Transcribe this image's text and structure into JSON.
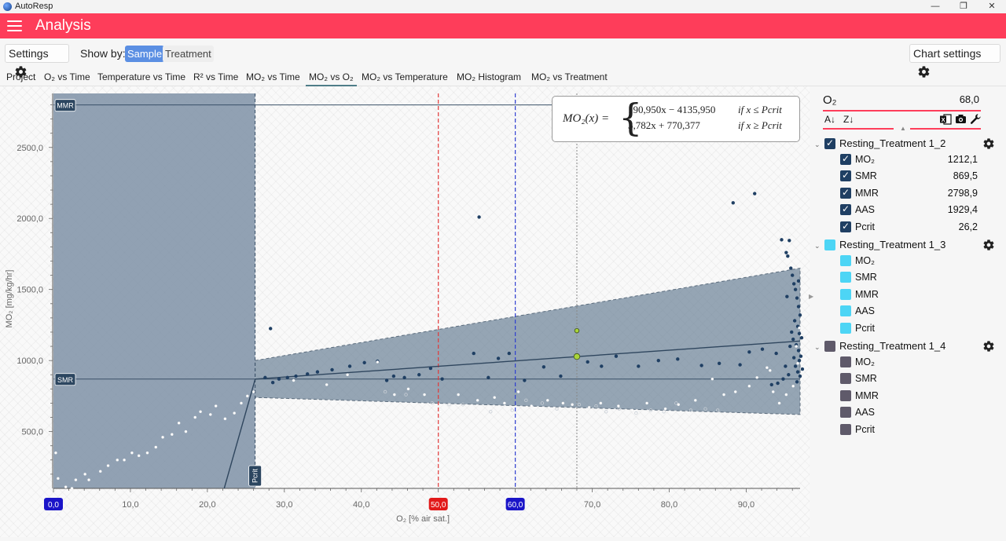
{
  "window": {
    "app_name": "AutoResp",
    "minimize": "—",
    "restore": "❐",
    "close": "✕"
  },
  "header": {
    "title": "Analysis"
  },
  "toolbar": {
    "settings_label": "Settings",
    "show_by_label": "Show by:",
    "show_by_options": [
      "Sample",
      "Treatment"
    ],
    "show_by_selected": "Sample",
    "chart_settings_label": "Chart settings"
  },
  "tabs": [
    {
      "label": "Project"
    },
    {
      "label": "O₂ vs Time"
    },
    {
      "label": "Temperature vs Time"
    },
    {
      "label": "R² vs Time"
    },
    {
      "label": "MO₂ vs Time"
    },
    {
      "label": "MO₂ vs O₂"
    },
    {
      "label": "MO₂ vs Temperature"
    },
    {
      "label": "MO₂ Histogram"
    },
    {
      "label": "MO₂ vs Treatment"
    }
  ],
  "selected_tab": "MO₂ vs O₂",
  "chart_data": {
    "type": "scatter",
    "xlabel": "O₂ [% air sat.]",
    "ylabel": "MO₂ [mg/kg/hr]",
    "xlim": [
      0,
      97
    ],
    "ylim": [
      100,
      2880
    ],
    "x_ticks": [
      "10,0",
      "20,0",
      "30,0",
      "40,0",
      "50,0",
      "60,0",
      "70,0",
      "80,0",
      "90,0"
    ],
    "y_ticks": [
      "500,0",
      "1000,0",
      "1500,0",
      "2000,0",
      "2500,0"
    ],
    "reference_lines": {
      "MMR": 2798.9,
      "SMR": 869.5,
      "Pcrit": 26.2,
      "x_marker_red": 50,
      "x_marker_blue": 60,
      "x_cursor": 68
    },
    "x_markers": [
      {
        "label": "0,0",
        "value": 0,
        "color": "#1a14c8"
      },
      {
        "label": "50,0",
        "value": 50,
        "color": "#e21a1a"
      },
      {
        "label": "60,0",
        "value": 60,
        "color": "#1a14c8"
      }
    ],
    "line_labels": [
      "MMR",
      "SMR",
      "Pcrit"
    ],
    "model": {
      "lhs": "MO₂(x) =",
      "case1_expr": "190,950x − 4135,950",
      "case1_cond": "if x ≤ Pcrit",
      "case2_expr": "3,782x + 770,377",
      "case2_cond": "if x ≥ Pcrit",
      "slope_low": 190.95,
      "intercept_low": -4135.95,
      "slope_high": 3.782,
      "intercept_high": 770.377,
      "band_start": [
        26.2,
        1000,
        740
      ],
      "band_end": [
        97,
        1650,
        620
      ]
    },
    "series": [
      {
        "name": "Resting_Treatment 1_2",
        "color": "#1f3f63",
        "points": [
          [
            28.2,
            1225
          ],
          [
            27.5,
            880
          ],
          [
            28.5,
            845
          ],
          [
            29.3,
            870
          ],
          [
            30.4,
            880
          ],
          [
            31.5,
            890
          ],
          [
            33,
            905
          ],
          [
            34.3,
            920
          ],
          [
            36.2,
            935
          ],
          [
            38.5,
            960
          ],
          [
            40.4,
            985
          ],
          [
            42.1,
            995
          ],
          [
            43.3,
            860
          ],
          [
            44.2,
            890
          ],
          [
            45.6,
            880
          ],
          [
            47.5,
            900
          ],
          [
            49,
            945
          ],
          [
            50.5,
            870
          ],
          [
            55.3,
            2010
          ],
          [
            54.6,
            1050
          ],
          [
            56.5,
            880
          ],
          [
            57.8,
            1015
          ],
          [
            59.2,
            1050
          ],
          [
            61.2,
            860
          ],
          [
            63.7,
            955
          ],
          [
            65.9,
            890
          ],
          [
            69.4,
            990
          ],
          [
            71.2,
            960
          ],
          [
            73.1,
            1030
          ],
          [
            76,
            960
          ],
          [
            78.6,
            1000
          ],
          [
            81.1,
            1010
          ],
          [
            84.2,
            965
          ],
          [
            88.3,
            2110
          ],
          [
            91.1,
            2175
          ],
          [
            86.5,
            980
          ],
          [
            89.2,
            970
          ],
          [
            90.4,
            1060
          ],
          [
            92.1,
            1080
          ],
          [
            93.3,
            830
          ],
          [
            94.1,
            840
          ],
          [
            94.6,
            1850
          ],
          [
            95.2,
            1760
          ],
          [
            95.6,
            1845
          ],
          [
            95.4,
            1735
          ],
          [
            95.8,
            1650
          ],
          [
            96,
            1600
          ],
          [
            96.2,
            1540
          ],
          [
            96.4,
            1500
          ],
          [
            96.6,
            1440
          ],
          [
            96.8,
            1380
          ],
          [
            97,
            1320
          ],
          [
            96.3,
            1280
          ],
          [
            96.7,
            1240
          ],
          [
            96.9,
            1190
          ],
          [
            96.1,
            1150
          ],
          [
            96.5,
            1110
          ],
          [
            96.8,
            1070
          ],
          [
            97.1,
            1030
          ],
          [
            96.9,
            1000
          ],
          [
            96.4,
            960
          ],
          [
            96.7,
            920
          ],
          [
            97,
            890
          ],
          [
            96.6,
            850
          ],
          [
            95.3,
            1450
          ],
          [
            95.9,
            1200
          ],
          [
            95.7,
            1100
          ],
          [
            96.2,
            1020
          ],
          [
            95.5,
            900
          ],
          [
            94.8,
            870
          ],
          [
            93.9,
            1050
          ],
          [
            95.1,
            960
          ],
          [
            96.8,
            1560
          ],
          [
            97.2,
            1160
          ],
          [
            97.3,
            940
          ]
        ]
      },
      {
        "name": "Resting_Treatment 1_3",
        "color": "#4dd5f5",
        "points": []
      },
      {
        "name": "Resting_Treatment 1_4",
        "color": "#ffffff",
        "points": [
          [
            0.3,
            350
          ],
          [
            0.6,
            170
          ],
          [
            1.6,
            110
          ],
          [
            2.4,
            100
          ],
          [
            2.9,
            160
          ],
          [
            4.1,
            200
          ],
          [
            4.6,
            160
          ],
          [
            6.1,
            220
          ],
          [
            7.1,
            260
          ],
          [
            8.3,
            300
          ],
          [
            9.2,
            300
          ],
          [
            10.2,
            350
          ],
          [
            11.1,
            330
          ],
          [
            12.2,
            350
          ],
          [
            13.3,
            390
          ],
          [
            14.2,
            460
          ],
          [
            15.4,
            480
          ],
          [
            16.3,
            560
          ],
          [
            17.2,
            500
          ],
          [
            18.4,
            600
          ],
          [
            19.1,
            640
          ],
          [
            20.4,
            620
          ],
          [
            21.1,
            680
          ],
          [
            22.3,
            590
          ],
          [
            23.5,
            630
          ],
          [
            24.4,
            700
          ],
          [
            25.2,
            750
          ],
          [
            26,
            780
          ],
          [
            31.2,
            860
          ],
          [
            35.5,
            830
          ],
          [
            38.2,
            900
          ],
          [
            42.1,
            990
          ],
          [
            44.3,
            760
          ],
          [
            46.1,
            800
          ],
          [
            48.2,
            760
          ],
          [
            50.3,
            640
          ],
          [
            52.6,
            760
          ],
          [
            55.1,
            720
          ],
          [
            57.3,
            740
          ],
          [
            58.6,
            700
          ],
          [
            60.4,
            780
          ],
          [
            62.1,
            680
          ],
          [
            64.2,
            720
          ],
          [
            66.2,
            700
          ],
          [
            67.4,
            690
          ],
          [
            69.6,
            670
          ],
          [
            71.1,
            700
          ],
          [
            73.4,
            680
          ],
          [
            75.2,
            650
          ],
          [
            77.1,
            700
          ],
          [
            79.5,
            660
          ],
          [
            81.2,
            690
          ],
          [
            83.4,
            720
          ],
          [
            85.6,
            870
          ],
          [
            87.1,
            760
          ],
          [
            88.6,
            780
          ],
          [
            90.4,
            820
          ],
          [
            92.7,
            950
          ],
          [
            93.5,
            780
          ],
          [
            95.2,
            760
          ],
          [
            96.1,
            820
          ],
          [
            96.7,
            980
          ],
          [
            96.5,
            1100
          ],
          [
            96.9,
            1230
          ],
          [
            97.2,
            870
          ],
          [
            94.3,
            700
          ],
          [
            93.1,
            930
          ],
          [
            91.4,
            880
          ]
        ]
      }
    ],
    "hollow_points": [
      [
        43.1,
        780
      ],
      [
        45.8,
        760
      ],
      [
        49.2,
        700
      ],
      [
        51.4,
        690
      ],
      [
        53.2,
        690
      ],
      [
        56.8,
        640
      ],
      [
        59.6,
        650
      ],
      [
        61.4,
        720
      ],
      [
        63.5,
        700
      ],
      [
        65.4,
        660
      ],
      [
        68.3,
        690
      ],
      [
        70.5,
        680
      ],
      [
        71.8,
        640
      ],
      [
        73.5,
        660
      ],
      [
        75.7,
        630
      ],
      [
        77.6,
        650
      ],
      [
        79.3,
        640
      ],
      [
        80.9,
        700
      ],
      [
        82.8,
        650
      ],
      [
        84.7,
        660
      ],
      [
        86.3,
        650
      ]
    ],
    "highlighted": [
      {
        "x": 68,
        "y": 1028,
        "color": "#a9d43a"
      },
      {
        "x": 68,
        "y": 1210,
        "color": "#a9d43a"
      }
    ]
  },
  "panel": {
    "selected_label": "O₂",
    "selected_value": "68,0",
    "sort_asc": "A↓",
    "sort_desc": "Z↓",
    "groups": [
      {
        "name": "Resting_Treatment 1_2",
        "color": "#1f3f63",
        "checked": true,
        "items": [
          {
            "label": "MO₂",
            "value": "1212,1"
          },
          {
            "label": "SMR",
            "value": "869,5"
          },
          {
            "label": "MMR",
            "value": "2798,9"
          },
          {
            "label": "AAS",
            "value": "1929,4"
          },
          {
            "label": "Pcrit",
            "value": "26,2"
          }
        ]
      },
      {
        "name": "Resting_Treatment 1_3",
        "color": "#4dd5f5",
        "checked": false,
        "items": [
          {
            "label": "MO₂",
            "value": ""
          },
          {
            "label": "SMR",
            "value": ""
          },
          {
            "label": "MMR",
            "value": ""
          },
          {
            "label": "AAS",
            "value": ""
          },
          {
            "label": "Pcrit",
            "value": ""
          }
        ]
      },
      {
        "name": "Resting_Treatment 1_4",
        "color": "#5f5a6a",
        "checked": false,
        "items": [
          {
            "label": "MO₂",
            "value": ""
          },
          {
            "label": "SMR",
            "value": ""
          },
          {
            "label": "MMR",
            "value": ""
          },
          {
            "label": "AAS",
            "value": ""
          },
          {
            "label": "Pcrit",
            "value": ""
          }
        ]
      }
    ]
  }
}
